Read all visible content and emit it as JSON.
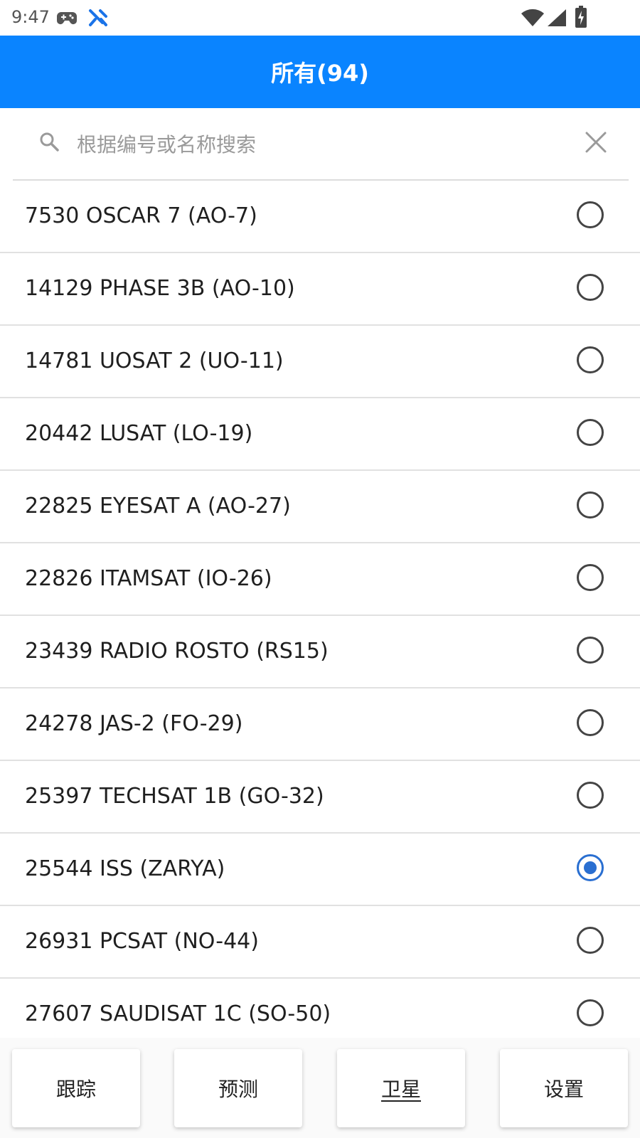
{
  "status_bar": {
    "time": "9:47",
    "icons": [
      "gamepad-icon",
      "app-notification-icon",
      "wifi-icon",
      "signal-icon",
      "battery-charging-icon"
    ]
  },
  "header": {
    "title": "所有(94)",
    "color": "#0a84ff"
  },
  "search": {
    "placeholder": "根据编号或名称搜索",
    "value": ""
  },
  "satellites": [
    {
      "label": "7530 OSCAR 7 (AO-7)",
      "selected": false
    },
    {
      "label": "14129 PHASE 3B (AO-10)",
      "selected": false
    },
    {
      "label": "14781 UOSAT 2 (UO-11)",
      "selected": false
    },
    {
      "label": "20442 LUSAT (LO-19)",
      "selected": false
    },
    {
      "label": "22825 EYESAT A (AO-27)",
      "selected": false
    },
    {
      "label": "22826 ITAMSAT (IO-26)",
      "selected": false
    },
    {
      "label": "23439 RADIO ROSTO (RS15)",
      "selected": false
    },
    {
      "label": "24278 JAS-2 (FO-29)",
      "selected": false
    },
    {
      "label": "25397 TECHSAT 1B (GO-32)",
      "selected": false
    },
    {
      "label": "25544 ISS (ZARYA)",
      "selected": true
    },
    {
      "label": "26931 PCSAT (NO-44)",
      "selected": false
    },
    {
      "label": "27607 SAUDISAT 1C (SO-50)",
      "selected": false
    }
  ],
  "bottom_nav": {
    "items": [
      {
        "label": "跟踪",
        "active": false
      },
      {
        "label": "预测",
        "active": false
      },
      {
        "label": "卫星",
        "active": true
      },
      {
        "label": "设置",
        "active": false
      }
    ]
  },
  "colors": {
    "accent": "#0a84ff",
    "radio_selected": "#2a6fd1"
  }
}
